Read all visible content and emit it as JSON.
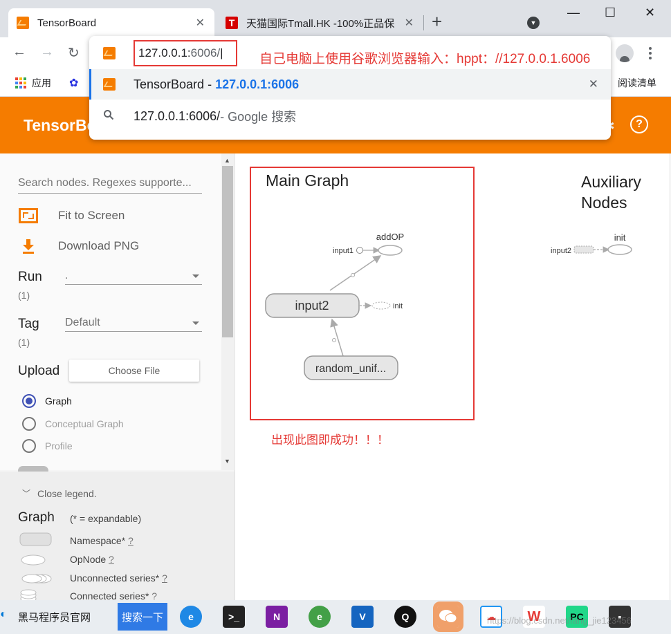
{
  "browser": {
    "tabs": [
      {
        "title": "TensorBoard",
        "favicon": "tensorboard-favicon",
        "active": true
      },
      {
        "title": "天猫国际Tmall.HK -100%正品保",
        "favicon": "tmall-favicon",
        "active": false
      }
    ],
    "favicon_letter_tmall": "T",
    "new_tab": "+",
    "close_glyph": "✕",
    "window_controls": {
      "minimize": "—",
      "maximize": "☐",
      "close": "✕"
    },
    "nav": {
      "back": "←",
      "forward": "→",
      "reload": "↻"
    },
    "bookmarks": {
      "apps_label": "应用",
      "reading_list": "阅读清单"
    },
    "omnibox": {
      "url_host": "127.0.0.1:",
      "url_port": "6006/",
      "annotation": "自己电脑上使用谷歌浏览器输入：hppt：//127.0.0.1.6006",
      "suggestions": [
        {
          "title": "TensorBoard",
          "separator": " - ",
          "url": "127.0.0.1:6006"
        },
        {
          "query": "127.0.0.1:6006/",
          "suffix": " - Google 搜索"
        }
      ]
    }
  },
  "tensorboard": {
    "title": "TensorBoard",
    "help_glyph": "?",
    "accent_color": "#f57c00",
    "sidebar": {
      "search_placeholder": "Search nodes. Regexes supporte...",
      "fit_to_screen": "Fit to Screen",
      "download_png": "Download PNG",
      "run_label": "Run",
      "run_count": "(1)",
      "run_value": ".",
      "tag_label": "Tag",
      "tag_count": "(1)",
      "tag_value": "Default",
      "upload_label": "Upload",
      "choose_file": "Choose File",
      "graph_modes": [
        {
          "label": "Graph",
          "checked": true
        },
        {
          "label": "Conceptual Graph",
          "checked": false
        },
        {
          "label": "Profile",
          "checked": false
        }
      ]
    },
    "legend": {
      "toggle": "Close legend.",
      "title": "Graph",
      "expandable_note": "(* = expandable)",
      "items": [
        {
          "label": "Namespace*",
          "help": "?"
        },
        {
          "label": "OpNode",
          "help": "?"
        },
        {
          "label": "Unconnected series*",
          "help": "?"
        },
        {
          "label": "Connected series*",
          "help": "?"
        }
      ]
    },
    "graph": {
      "main_title": "Main Graph",
      "aux_title_line1": "Auxiliary",
      "aux_title_line2": "Nodes",
      "nodes": {
        "addop": "addOP",
        "input1": "input1",
        "input2": "input2",
        "init_small": "init",
        "random": "random_unif...",
        "aux_input2": "input2",
        "aux_init": "init"
      },
      "success_note": "出现此图即成功！！！",
      "frame_color": "#e53935"
    }
  },
  "taskbar": {
    "site": "黑马程序员官网",
    "search_button": "搜索一下",
    "apps": [
      "edge-icon",
      "terminal-icon",
      "onenote-icon",
      "ie-icon",
      "visual-studio-icon",
      "qq-icon",
      "wechat-icon",
      "baidu-netdisk-icon",
      "wps-icon",
      "pycharm-icon",
      "cmd-icon"
    ],
    "watermark": "https://blog.csdn.net/fang_jie123456"
  }
}
